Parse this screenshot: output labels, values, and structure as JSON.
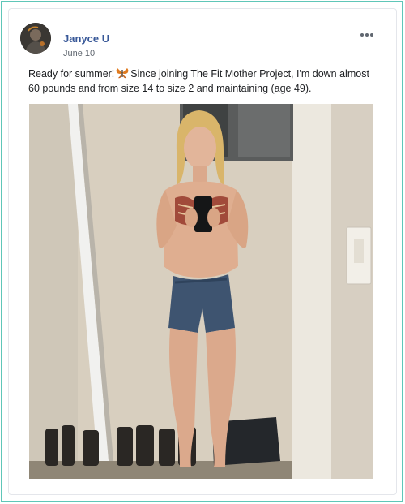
{
  "post": {
    "author": "Janyce U",
    "date": "June 10",
    "text_before_emoji": "Ready for summer!",
    "emoji": "butterfly",
    "text_after_emoji": "Since joining The Fit Mother Project, I'm down almost 60 pounds and from size 14 to size 2 and maintaining (age 49).",
    "more_options_icon": "ellipsis-icon"
  },
  "colors": {
    "author_link": "#385898",
    "frame_border": "#5fc6b8",
    "secondary_text": "#606770"
  }
}
